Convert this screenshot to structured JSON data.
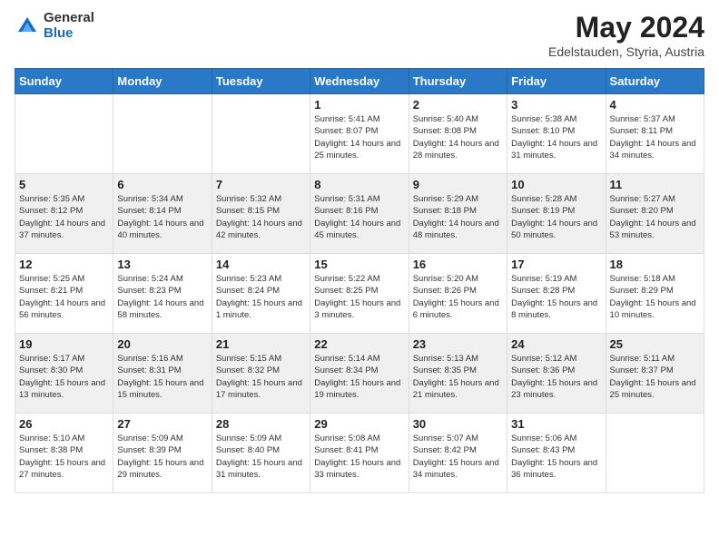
{
  "header": {
    "logo_general": "General",
    "logo_blue": "Blue",
    "title": "May 2024",
    "subtitle": "Edelstauden, Styria, Austria"
  },
  "days_of_week": [
    "Sunday",
    "Monday",
    "Tuesday",
    "Wednesday",
    "Thursday",
    "Friday",
    "Saturday"
  ],
  "weeks": [
    [
      {
        "num": "",
        "sunrise": "",
        "sunset": "",
        "daylight": ""
      },
      {
        "num": "",
        "sunrise": "",
        "sunset": "",
        "daylight": ""
      },
      {
        "num": "",
        "sunrise": "",
        "sunset": "",
        "daylight": ""
      },
      {
        "num": "1",
        "sunrise": "Sunrise: 5:41 AM",
        "sunset": "Sunset: 8:07 PM",
        "daylight": "Daylight: 14 hours and 25 minutes."
      },
      {
        "num": "2",
        "sunrise": "Sunrise: 5:40 AM",
        "sunset": "Sunset: 8:08 PM",
        "daylight": "Daylight: 14 hours and 28 minutes."
      },
      {
        "num": "3",
        "sunrise": "Sunrise: 5:38 AM",
        "sunset": "Sunset: 8:10 PM",
        "daylight": "Daylight: 14 hours and 31 minutes."
      },
      {
        "num": "4",
        "sunrise": "Sunrise: 5:37 AM",
        "sunset": "Sunset: 8:11 PM",
        "daylight": "Daylight: 14 hours and 34 minutes."
      }
    ],
    [
      {
        "num": "5",
        "sunrise": "Sunrise: 5:35 AM",
        "sunset": "Sunset: 8:12 PM",
        "daylight": "Daylight: 14 hours and 37 minutes."
      },
      {
        "num": "6",
        "sunrise": "Sunrise: 5:34 AM",
        "sunset": "Sunset: 8:14 PM",
        "daylight": "Daylight: 14 hours and 40 minutes."
      },
      {
        "num": "7",
        "sunrise": "Sunrise: 5:32 AM",
        "sunset": "Sunset: 8:15 PM",
        "daylight": "Daylight: 14 hours and 42 minutes."
      },
      {
        "num": "8",
        "sunrise": "Sunrise: 5:31 AM",
        "sunset": "Sunset: 8:16 PM",
        "daylight": "Daylight: 14 hours and 45 minutes."
      },
      {
        "num": "9",
        "sunrise": "Sunrise: 5:29 AM",
        "sunset": "Sunset: 8:18 PM",
        "daylight": "Daylight: 14 hours and 48 minutes."
      },
      {
        "num": "10",
        "sunrise": "Sunrise: 5:28 AM",
        "sunset": "Sunset: 8:19 PM",
        "daylight": "Daylight: 14 hours and 50 minutes."
      },
      {
        "num": "11",
        "sunrise": "Sunrise: 5:27 AM",
        "sunset": "Sunset: 8:20 PM",
        "daylight": "Daylight: 14 hours and 53 minutes."
      }
    ],
    [
      {
        "num": "12",
        "sunrise": "Sunrise: 5:25 AM",
        "sunset": "Sunset: 8:21 PM",
        "daylight": "Daylight: 14 hours and 56 minutes."
      },
      {
        "num": "13",
        "sunrise": "Sunrise: 5:24 AM",
        "sunset": "Sunset: 8:23 PM",
        "daylight": "Daylight: 14 hours and 58 minutes."
      },
      {
        "num": "14",
        "sunrise": "Sunrise: 5:23 AM",
        "sunset": "Sunset: 8:24 PM",
        "daylight": "Daylight: 15 hours and 1 minute."
      },
      {
        "num": "15",
        "sunrise": "Sunrise: 5:22 AM",
        "sunset": "Sunset: 8:25 PM",
        "daylight": "Daylight: 15 hours and 3 minutes."
      },
      {
        "num": "16",
        "sunrise": "Sunrise: 5:20 AM",
        "sunset": "Sunset: 8:26 PM",
        "daylight": "Daylight: 15 hours and 6 minutes."
      },
      {
        "num": "17",
        "sunrise": "Sunrise: 5:19 AM",
        "sunset": "Sunset: 8:28 PM",
        "daylight": "Daylight: 15 hours and 8 minutes."
      },
      {
        "num": "18",
        "sunrise": "Sunrise: 5:18 AM",
        "sunset": "Sunset: 8:29 PM",
        "daylight": "Daylight: 15 hours and 10 minutes."
      }
    ],
    [
      {
        "num": "19",
        "sunrise": "Sunrise: 5:17 AM",
        "sunset": "Sunset: 8:30 PM",
        "daylight": "Daylight: 15 hours and 13 minutes."
      },
      {
        "num": "20",
        "sunrise": "Sunrise: 5:16 AM",
        "sunset": "Sunset: 8:31 PM",
        "daylight": "Daylight: 15 hours and 15 minutes."
      },
      {
        "num": "21",
        "sunrise": "Sunrise: 5:15 AM",
        "sunset": "Sunset: 8:32 PM",
        "daylight": "Daylight: 15 hours and 17 minutes."
      },
      {
        "num": "22",
        "sunrise": "Sunrise: 5:14 AM",
        "sunset": "Sunset: 8:34 PM",
        "daylight": "Daylight: 15 hours and 19 minutes."
      },
      {
        "num": "23",
        "sunrise": "Sunrise: 5:13 AM",
        "sunset": "Sunset: 8:35 PM",
        "daylight": "Daylight: 15 hours and 21 minutes."
      },
      {
        "num": "24",
        "sunrise": "Sunrise: 5:12 AM",
        "sunset": "Sunset: 8:36 PM",
        "daylight": "Daylight: 15 hours and 23 minutes."
      },
      {
        "num": "25",
        "sunrise": "Sunrise: 5:11 AM",
        "sunset": "Sunset: 8:37 PM",
        "daylight": "Daylight: 15 hours and 25 minutes."
      }
    ],
    [
      {
        "num": "26",
        "sunrise": "Sunrise: 5:10 AM",
        "sunset": "Sunset: 8:38 PM",
        "daylight": "Daylight: 15 hours and 27 minutes."
      },
      {
        "num": "27",
        "sunrise": "Sunrise: 5:09 AM",
        "sunset": "Sunset: 8:39 PM",
        "daylight": "Daylight: 15 hours and 29 minutes."
      },
      {
        "num": "28",
        "sunrise": "Sunrise: 5:09 AM",
        "sunset": "Sunset: 8:40 PM",
        "daylight": "Daylight: 15 hours and 31 minutes."
      },
      {
        "num": "29",
        "sunrise": "Sunrise: 5:08 AM",
        "sunset": "Sunset: 8:41 PM",
        "daylight": "Daylight: 15 hours and 33 minutes."
      },
      {
        "num": "30",
        "sunrise": "Sunrise: 5:07 AM",
        "sunset": "Sunset: 8:42 PM",
        "daylight": "Daylight: 15 hours and 34 minutes."
      },
      {
        "num": "31",
        "sunrise": "Sunrise: 5:06 AM",
        "sunset": "Sunset: 8:43 PM",
        "daylight": "Daylight: 15 hours and 36 minutes."
      },
      {
        "num": "",
        "sunrise": "",
        "sunset": "",
        "daylight": ""
      }
    ]
  ]
}
